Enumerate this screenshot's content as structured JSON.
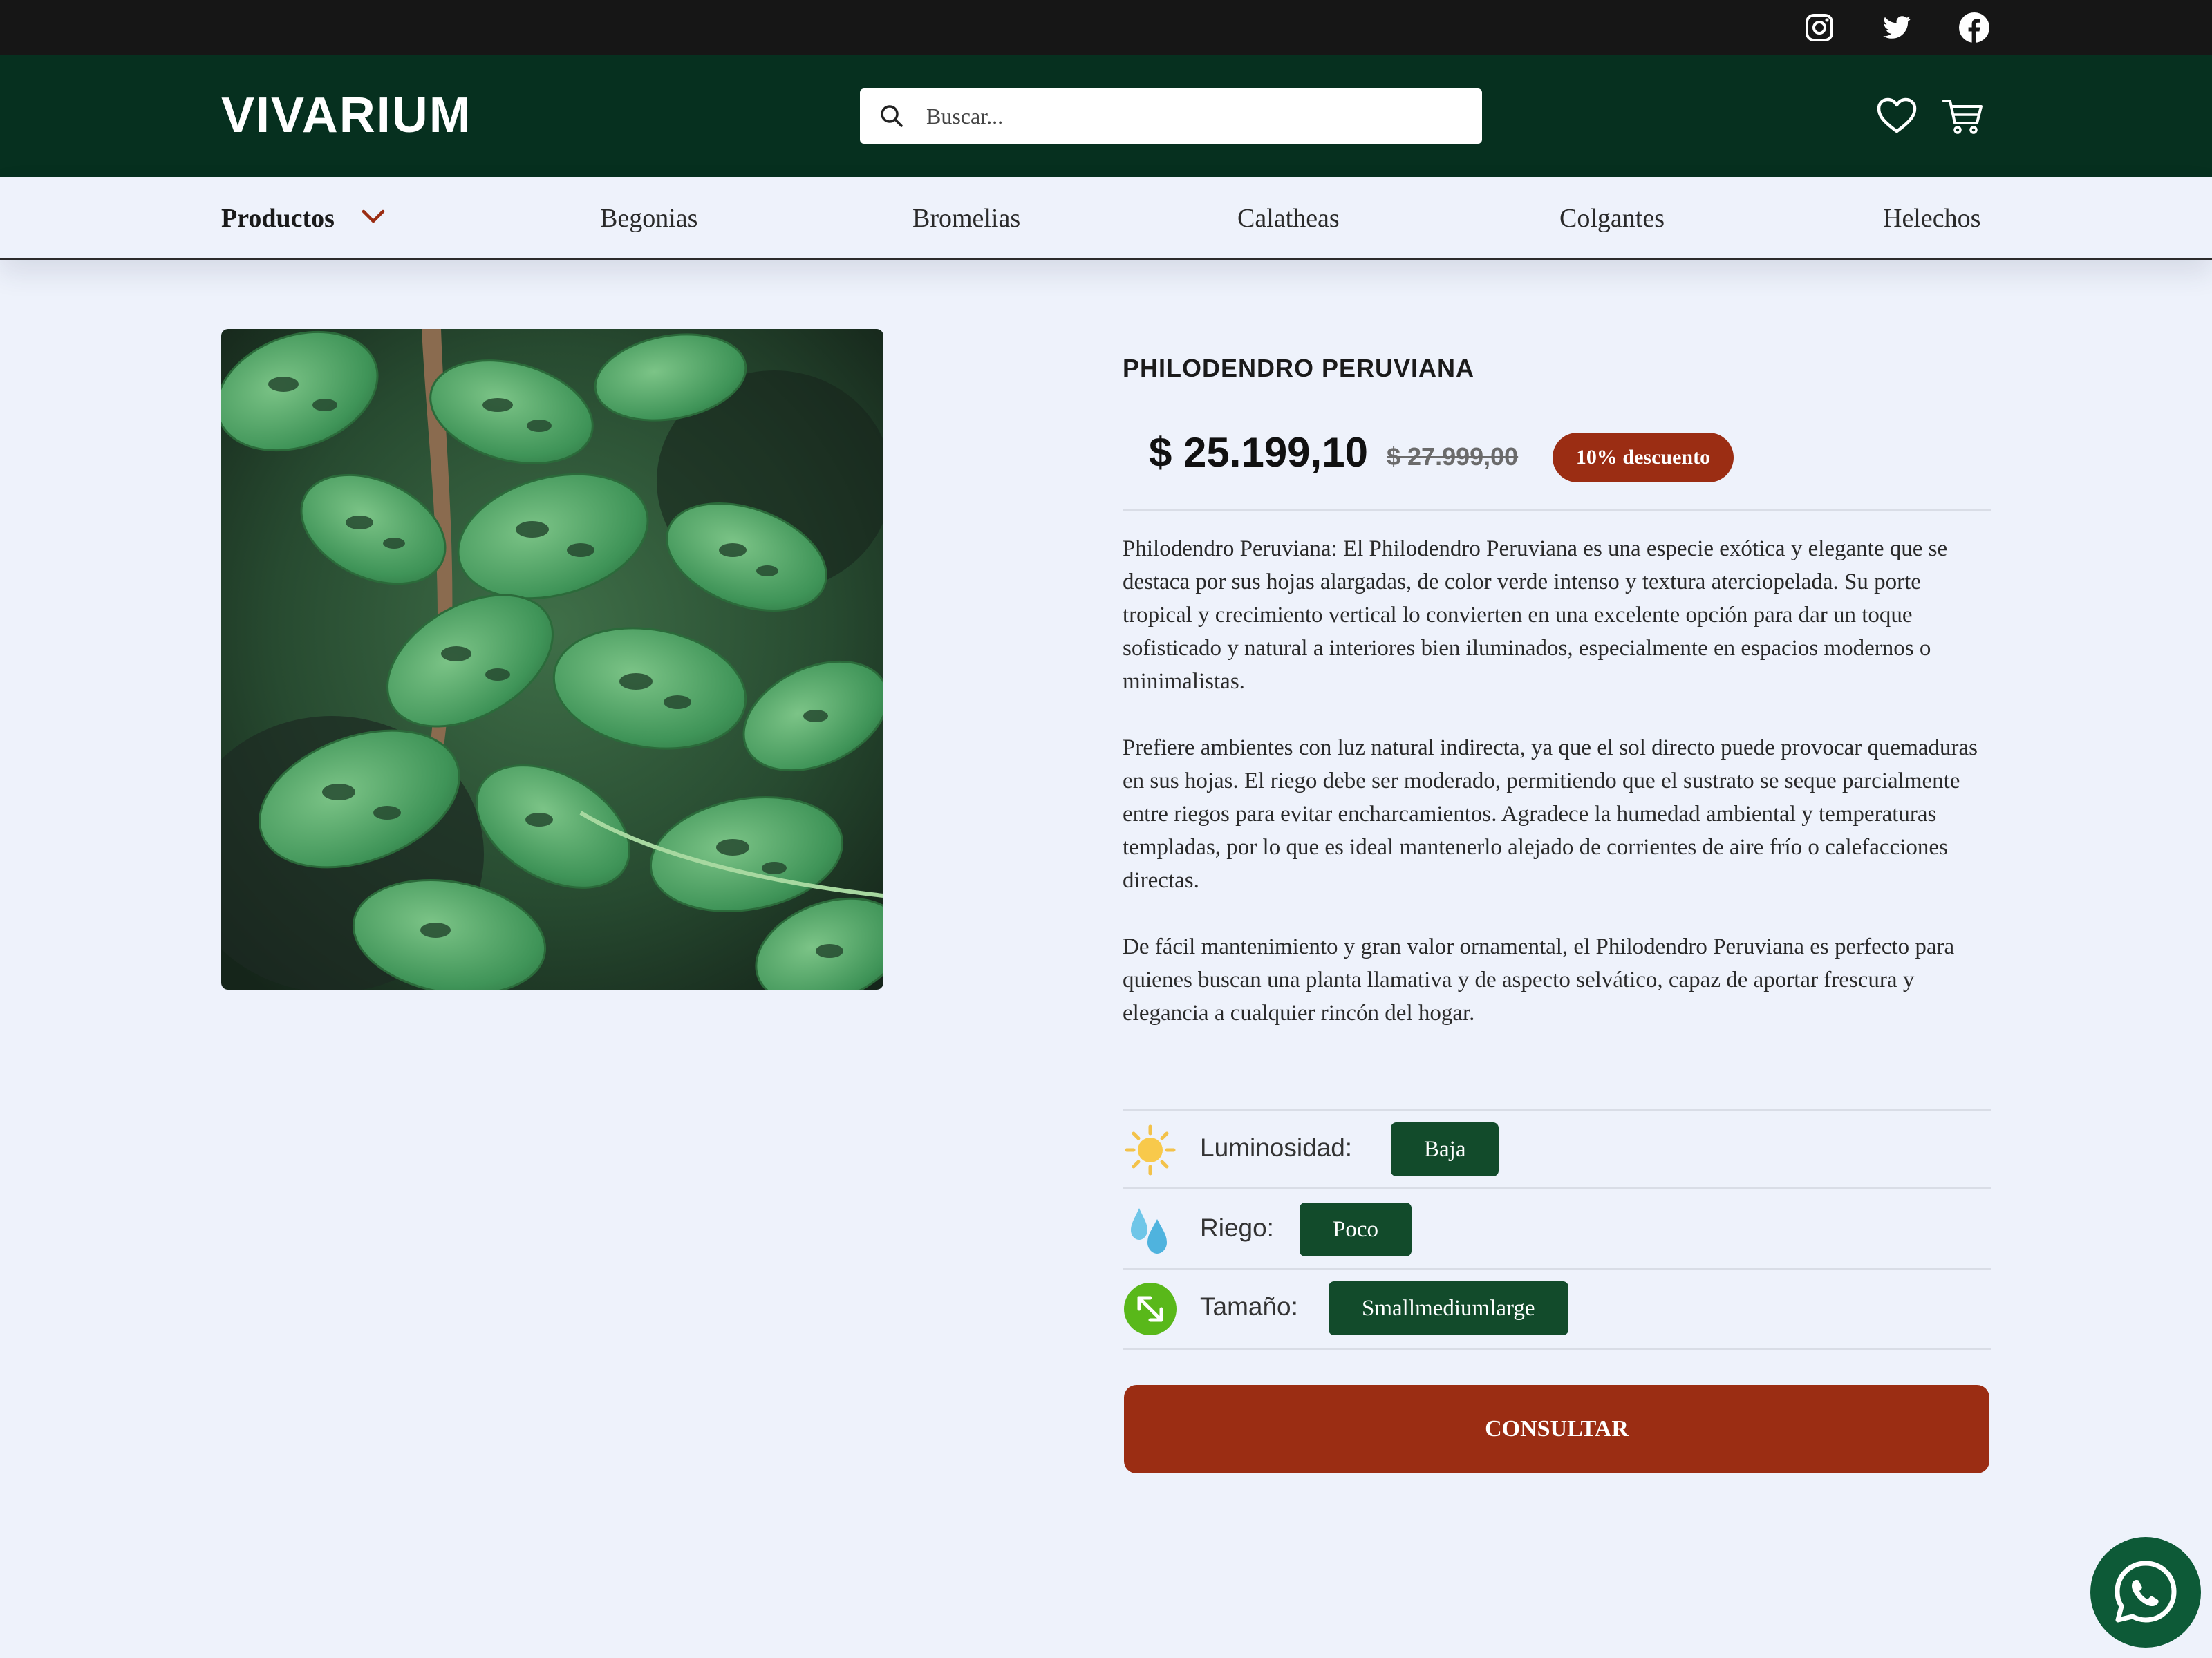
{
  "social": [
    "instagram-icon",
    "twitter-icon",
    "facebook-icon"
  ],
  "header": {
    "logo": "VIVARIUM",
    "search_placeholder": "Buscar..."
  },
  "nav": {
    "products_label": "Productos",
    "items": [
      "Begonias",
      "Bromelias",
      "Calatheas",
      "Colgantes",
      "Helechos"
    ]
  },
  "product": {
    "name": "PHILODENDRO PERUVIANA",
    "price": "$ 25.199,10",
    "old_price": "$ 27.999,00",
    "discount_badge": "10% descuento",
    "description": [
      "Philodendro Peruviana: El Philodendro Peruviana es una especie exótica y elegante que se destaca por sus hojas alargadas, de color verde intenso y textura aterciopelada. Su porte tropical y crecimiento vertical lo convierten en una excelente opción para dar un toque sofisticado y natural a interiores bien iluminados, especialmente en espacios modernos o minimalistas.",
      "Prefiere ambientes con luz natural indirecta, ya que el sol directo puede provocar quemaduras en sus hojas. El riego debe ser moderado, permitiendo que el sustrato se seque parcialmente entre riegos para evitar encharcamientos. Agradece la humedad ambiental y temperaturas templadas, por lo que es ideal mantenerlo alejado de corrientes de aire frío o calefacciones directas.",
      "De fácil mantenimiento y gran valor ornamental, el Philodendro Peruviana es perfecto para quienes buscan una planta llamativa y de aspecto selvático, capaz de aportar frescura y elegancia a cualquier rincón del hogar."
    ],
    "attributes": {
      "light": {
        "label": "Luminosidad:",
        "value": "Baja",
        "icon": "sun-icon"
      },
      "water": {
        "label": "Riego:",
        "value": "Poco",
        "icon": "water-drops-icon"
      },
      "size": {
        "label": "Tamaño:",
        "value": "Smallmediumlarge",
        "icon": "resize-arrows-icon"
      }
    },
    "cta_label": "CONSULTAR"
  },
  "colors": {
    "header_bg": "#06301f",
    "accent": "#9b2d13",
    "chip": "#124b2b",
    "page_bg": "#eef2fb"
  }
}
